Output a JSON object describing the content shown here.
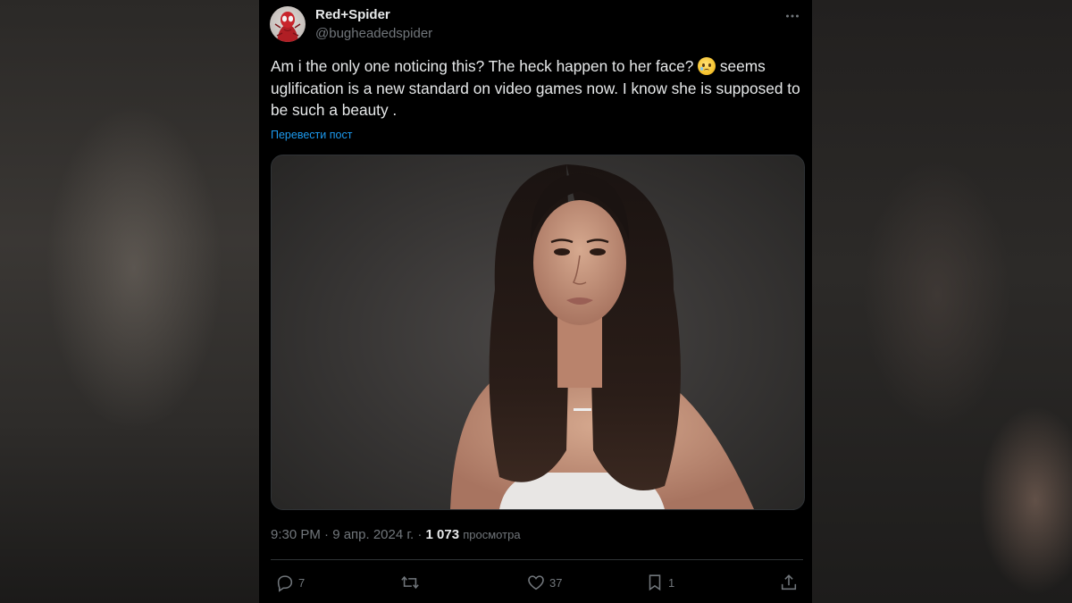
{
  "post": {
    "author": {
      "display_name": "Red+Spider",
      "handle": "@bugheadedspider"
    },
    "text_part1": "Am i the only one noticing this? The heck happen to her face? ",
    "emoji": "pleading-face-emoji",
    "text_part2": " seems uglification is a new standard on video games now.  I know she is supposed to be such a beauty .",
    "translate_label": "Перевести пост",
    "timestamp": "9:30 PM · 9 апр. 2024 г. · ",
    "views_count": "1 073",
    "views_label": "просмотра",
    "actions": {
      "replies": "7",
      "retweets": "",
      "likes": "37",
      "bookmarks": "1"
    }
  },
  "icons": {
    "more": "more-horizontal-icon",
    "reply": "reply-icon",
    "retweet": "retweet-icon",
    "like": "heart-icon",
    "bookmark": "bookmark-icon",
    "share": "share-icon"
  },
  "colors": {
    "background": "#000000",
    "text": "#e7e9ea",
    "muted": "#71767b",
    "link": "#1d9bf0"
  }
}
